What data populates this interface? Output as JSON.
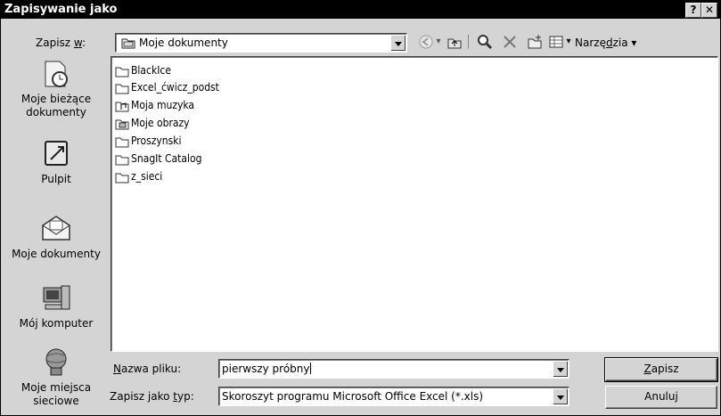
{
  "window": {
    "title": "Zapisywanie jako",
    "help_label": "?",
    "close_label": "✕"
  },
  "save_in": {
    "label_pre": "Zapisz ",
    "label_key": "w",
    "label_post": ":",
    "value": "Moje dokumenty"
  },
  "toolbar": {
    "tools_label_pre": "Narzę",
    "tools_label_key": "d",
    "tools_label_post": "zia"
  },
  "places": [
    {
      "label": "Moje bieżące dokumenty",
      "icon": "recent-documents-icon"
    },
    {
      "label": "Pulpit",
      "icon": "desktop-icon"
    },
    {
      "label": "Moje dokumenty",
      "icon": "my-documents-icon"
    },
    {
      "label": "Mój komputer",
      "icon": "my-computer-icon"
    },
    {
      "label": "Moje miejsca sieciowe",
      "icon": "network-places-icon"
    }
  ],
  "files": [
    {
      "name": "BlackIce",
      "icon": "folder-icon"
    },
    {
      "name": "Excel_ćwicz_podst",
      "icon": "folder-icon"
    },
    {
      "name": "Moja muzyka",
      "icon": "music-folder-icon"
    },
    {
      "name": "Moje obrazy",
      "icon": "pictures-folder-icon"
    },
    {
      "name": "Proszynski",
      "icon": "folder-icon"
    },
    {
      "name": "SnagIt Catalog",
      "icon": "folder-icon"
    },
    {
      "name": "z_sieci",
      "icon": "folder-icon"
    }
  ],
  "filename": {
    "label_key": "N",
    "label_rest": "azwa pliku:",
    "value": "pierwszy próbny"
  },
  "filetype": {
    "label_pre": "Zapisz jako ",
    "label_key": "t",
    "label_post": "yp:",
    "value": "Skoroszyt programu Microsoft Office Excel (*.xls)"
  },
  "buttons": {
    "save_key": "Z",
    "save_rest": "apisz",
    "cancel": "Anuluj"
  }
}
